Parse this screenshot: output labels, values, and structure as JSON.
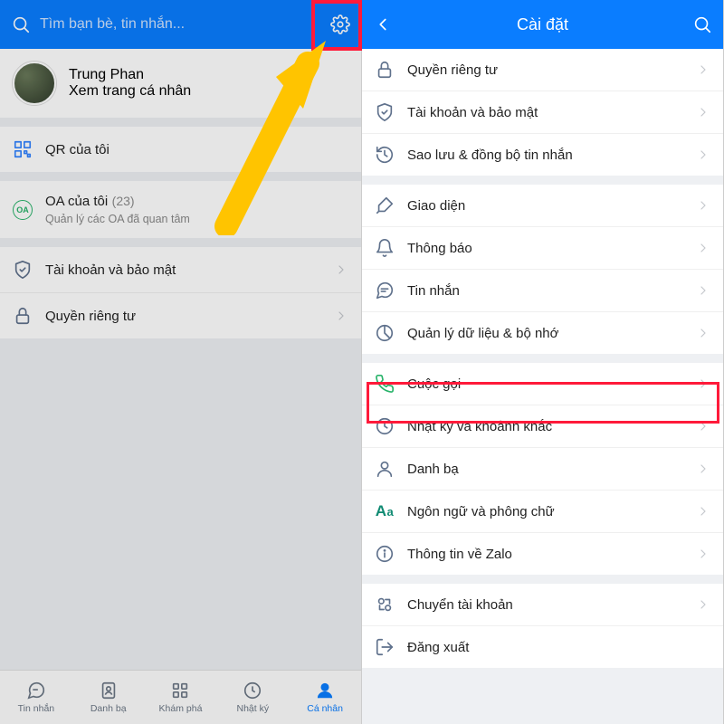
{
  "left": {
    "search_placeholder": "Tìm bạn bè, tin nhắn...",
    "profile": {
      "name": "Trung Phan",
      "subtitle": "Xem trang cá nhân"
    },
    "rows": {
      "qr": "QR của tôi",
      "oa_title": "OA của tôi",
      "oa_count": "(23)",
      "oa_sub": "Quản lý các OA đã quan tâm",
      "security": "Tài khoản và bảo mật",
      "privacy": "Quyền riêng tư"
    },
    "tabs": {
      "messages": "Tin nhắn",
      "contacts": "Danh bạ",
      "explore": "Khám phá",
      "journal": "Nhật ký",
      "me": "Cá nhân"
    }
  },
  "right": {
    "title": "Cài đặt",
    "items": {
      "privacy": "Quyền riêng tư",
      "security": "Tài khoản và bảo mật",
      "backup": "Sao lưu & đồng bộ tin nhắn",
      "theme": "Giao diện",
      "notify": "Thông báo",
      "message": "Tin nhắn",
      "data": "Quản lý dữ liệu & bộ nhớ",
      "call": "Cuộc gọi",
      "journal": "Nhật ký và khoảnh khắc",
      "contacts": "Danh bạ",
      "lang": "Ngôn ngữ và phông chữ",
      "about": "Thông tin về Zalo",
      "switch": "Chuyển tài khoản",
      "logout": "Đăng xuất"
    }
  },
  "icons": {
    "oa_label": "OA"
  }
}
